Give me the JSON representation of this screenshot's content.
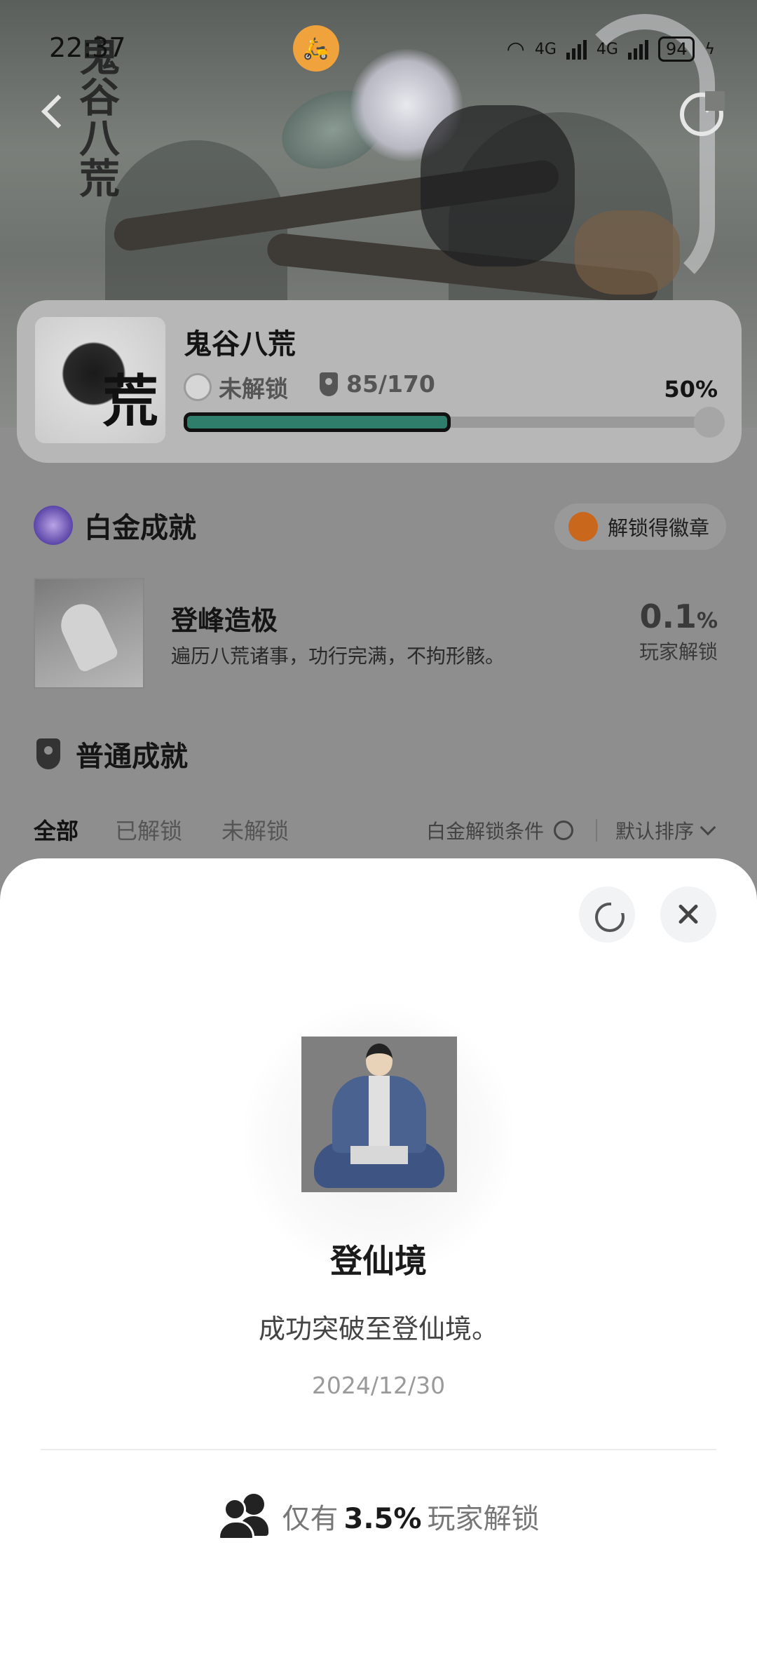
{
  "status_bar": {
    "time": "22:37",
    "network_1": "4G",
    "network_2": "4G",
    "battery": "94"
  },
  "banner": {
    "calligraphy": "鬼谷八荒"
  },
  "game": {
    "title": "鬼谷八荒",
    "lock_status": "未解锁",
    "trophies": "85/170",
    "progress_percent": "50%",
    "progress_fraction": 0.5
  },
  "platinum": {
    "section_title": "白金成就",
    "badge_chip": "解锁得徽章",
    "item": {
      "name": "登峰造极",
      "description": "遍历八荒诸事，功行完满，不拘形骸。",
      "rate_value": "0.1",
      "rate_unit": "%",
      "rate_label": "玩家解锁"
    }
  },
  "normal": {
    "section_title": "普通成就"
  },
  "filters": {
    "tabs": [
      "全部",
      "已解锁",
      "未解锁"
    ],
    "active_tab": "全部",
    "condition": "白金解锁条件",
    "sort": "默认排序"
  },
  "sheet": {
    "achievement_title": "登仙境",
    "achievement_desc": "成功突破至登仙境。",
    "date": "2024/12/30",
    "rate_prefix": "仅有",
    "rate_value": "3.5%",
    "rate_suffix": "玩家解锁"
  },
  "icons": {
    "back": "chevron-left-icon",
    "share": "share-icon",
    "close": "close-icon",
    "users": "users-icon",
    "trophy": "trophy-icon"
  },
  "colors": {
    "progress": "#2f7d6b",
    "status_app": "#f0a23c",
    "badge": "#c9681d"
  }
}
